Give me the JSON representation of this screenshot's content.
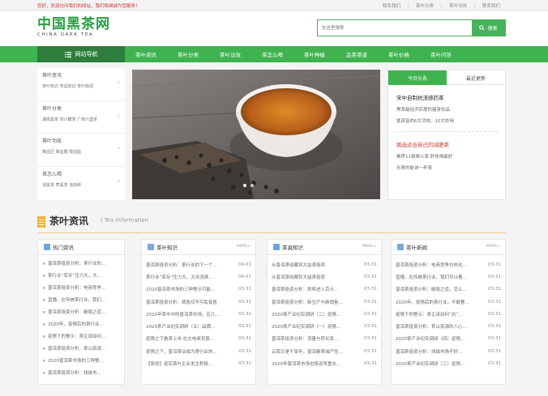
{
  "topbar": {
    "welcome": "您好，欢迎访问我们的网站，我们将竭诚为您服务！",
    "links": [
      "联系我们",
      "茶叶分类",
      "茶叶功效",
      "联系我们"
    ]
  },
  "logo": {
    "cn": "中国黑茶网",
    "en": "CHINA DARK TEA"
  },
  "search": {
    "placeholder": "在这里搜索",
    "button": "搜索"
  },
  "nav": {
    "home": "网站导航",
    "items": [
      "茶叶资讯",
      "茶叶分类",
      "茶叶功效",
      "茶怎么喝",
      "茶叶种植",
      "品茶茶道",
      "茶叶价格",
      "茶叶问答"
    ]
  },
  "sidebar": {
    "items": [
      {
        "title": "茶叶资讯",
        "sub": "茶叶知识  茶具知识  茶叶新闻"
      },
      {
        "title": "茶叶分类",
        "sub": "湖南黑茶  四川藏茶  广西六堡茶"
      },
      {
        "title": "茶叶功效",
        "sub": "降血压  降血糖  降血脂"
      },
      {
        "title": "茶怎么喝",
        "sub": "泡黑茶  煮黑茶  泡茯砖"
      }
    ]
  },
  "news": {
    "tabs": [
      "今日头条",
      "最近更新"
    ],
    "head1": "宋中自制抗流感药茶",
    "lines1": [
      "黑茶最经济实惠的瘦身饮品",
      "铁观音的6大功效、10大妙用"
    ],
    "head2": "挑选适合自己的减肥茶",
    "lines2": [
      "推荐11款降火茶 肝热喝最好",
      "长寿的秘诀一杯茶"
    ]
  },
  "section": {
    "title": "茶叶资讯",
    "subtitle": "/ Tea Information"
  },
  "hot": {
    "title": "热门资讯",
    "items": [
      "普洱茶投资分析：茶行业的...",
      "茶行业“库存”压力大，大...",
      "普洱茶投资分析：电商竞争...",
      "直播，在传统茶行业，我们...",
      "普洱茶投资分析：破局之道...",
      "2020年，疫情后的茶行业...",
      "疫情下的警示：茶企该如何...",
      "普洱茶投资分析：茶山资源...",
      "2020普洱茶市场的三种警...",
      "普洱茶投资分析：线级市..."
    ]
  },
  "columns": [
    {
      "title": "茶叶知识",
      "more": "MORE+",
      "rows": [
        {
          "t": "普洱茶投资分析：茶行业的下一个...",
          "d": "04-01"
        },
        {
          "t": "茶行业“库存”压力大，大众消费...",
          "d": "04-01"
        },
        {
          "t": "2020普洱茶市场的三种警示可能...",
          "d": "03-31"
        },
        {
          "t": "普洱茶投资分析：病急切不可乱投医",
          "d": "03-31"
        },
        {
          "t": "2020年草中中的普洱茶市场，应几...",
          "d": "03-31"
        },
        {
          "t": "2020茶产业纪实调研（五）品牌...",
          "d": "03-31"
        },
        {
          "t": "疫情之下看茶上市 社交电商背景...",
          "d": "03-31"
        },
        {
          "t": "疫情之下，普洱茶业成为茶行业的...",
          "d": "03-31"
        },
        {
          "t": "【原创】疫后茶叶企业发生积极...",
          "d": "03-31"
        }
      ]
    },
    {
      "title": "茶具知识",
      "more": "MORE+",
      "rows": [
        {
          "t": "从普洱茶收藏到大益茶投资",
          "d": "03-31"
        },
        {
          "t": "从普洱茶收藏到大益茶投资",
          "d": "03-31"
        },
        {
          "t": "普洱茶投资分析：即将进入百元...",
          "d": "03-31"
        },
        {
          "t": "普洱茶投资分析：新生产与新销售...",
          "d": "03-31"
        },
        {
          "t": "2020茶产业纪实调研（二）疫情...",
          "d": "03-31"
        },
        {
          "t": "2020茶产业纪实调研（一）疫情...",
          "d": "03-31"
        },
        {
          "t": "普洱茶投资分析：流量与转化率...",
          "d": "03-31"
        },
        {
          "t": "云南又是干旱年，普洱春茶减产性...",
          "d": "03-31"
        },
        {
          "t": "2020年普洱茶市场也将迎来重去...",
          "d": "03-31"
        }
      ]
    },
    {
      "title": "茶叶新闻",
      "more": "MORE+",
      "rows": [
        {
          "t": "普洱茶投资分析：电商竞争白热化...",
          "d": "03-31"
        },
        {
          "t": "直播，在传统茶行业，我们可以看...",
          "d": "03-31"
        },
        {
          "t": "普洱茶投资分析：破局之道，怎么...",
          "d": "03-31"
        },
        {
          "t": "2020年，疫情后的茶行业，不敢奢...",
          "d": "03-31"
        },
        {
          "t": "疫情下的警示：茶企该如何“抗”...",
          "d": "03-31"
        },
        {
          "t": "普洱茶投资分析：茶山资源的人心...",
          "d": "03-31"
        },
        {
          "t": "2020茶产业纪实调研（四）疫情...",
          "d": "03-31"
        },
        {
          "t": "普洱茶投资分析：线级市场不好...",
          "d": "03-31"
        },
        {
          "t": "2020茶产业纪实调研（三）疫情...",
          "d": "03-31"
        }
      ]
    }
  ],
  "colors": {
    "green": "#3fb350",
    "darkgreen": "#2e7d3c",
    "red": "#cc3333",
    "orange": "#f5b03a"
  }
}
